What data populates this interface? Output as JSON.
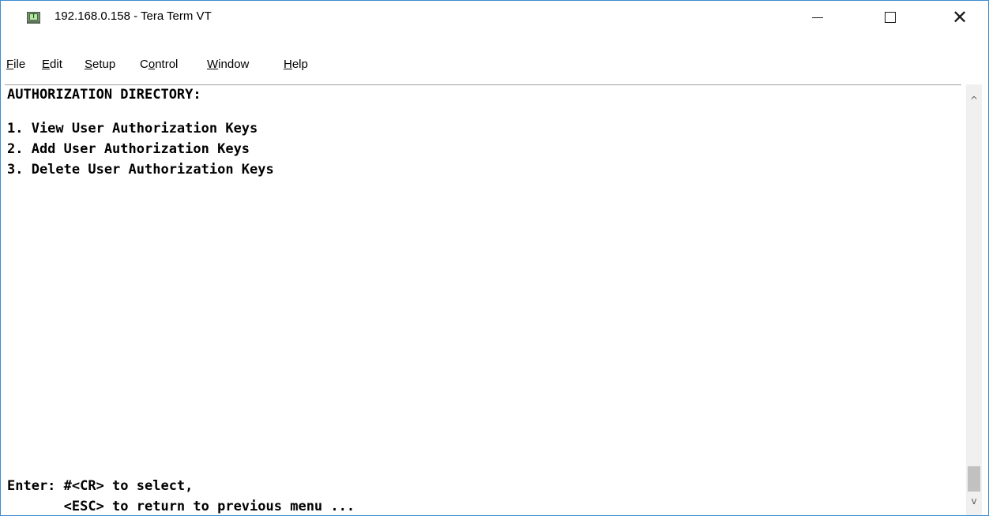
{
  "window": {
    "title": "192.168.0.158 - Tera Term VT",
    "icon": "tera-term-icon",
    "icon_letter": "T",
    "controls": {
      "minimize": "minimize-icon",
      "maximize": "maximize-icon",
      "close": "close-icon",
      "close_glyph": "✕"
    }
  },
  "menu": {
    "items": [
      {
        "accel": "F",
        "rest": "ile"
      },
      {
        "accel": "E",
        "rest": "dit"
      },
      {
        "accel": "S",
        "rest": "etup"
      },
      {
        "pre": "C",
        "accel": "o",
        "rest": "ntrol"
      },
      {
        "accel": "W",
        "rest": "indow"
      },
      {
        "accel": "H",
        "rest": "elp"
      }
    ]
  },
  "terminal": {
    "lines": [
      "AUTHORIZATION DIRECTORY:",
      "",
      "1. View User Authorization Keys",
      "2. Add User Authorization Keys",
      "3. Delete User Authorization Keys"
    ],
    "footer": [
      "Enter: #<CR> to select,",
      "       <ESC> to return to previous menu ..."
    ]
  },
  "scrollbar": {
    "up_arrow": "^",
    "down_arrow": "v"
  }
}
